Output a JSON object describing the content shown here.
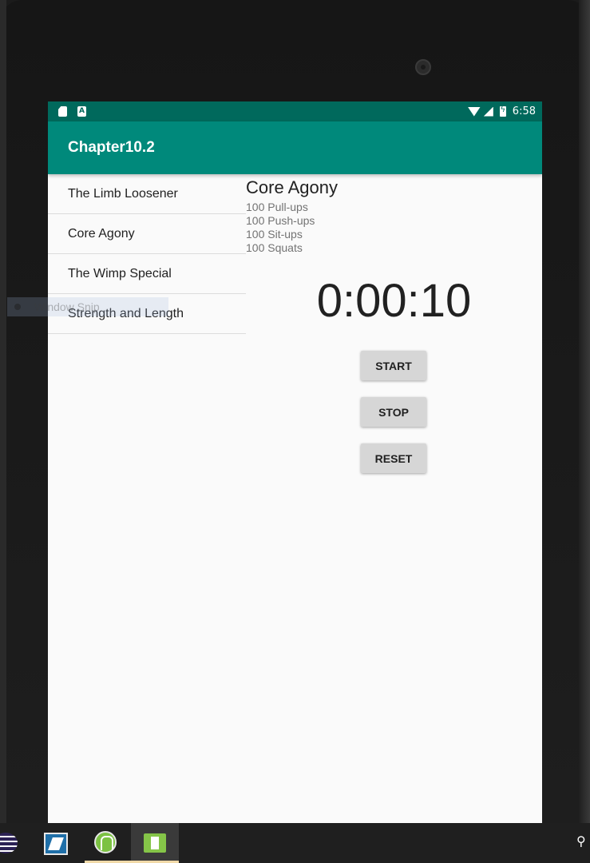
{
  "status_bar": {
    "time": "6:58",
    "icons": [
      "sd-card-icon",
      "a-badge-icon",
      "wifi-icon",
      "cell-signal-icon",
      "battery-charging-icon"
    ]
  },
  "app_bar": {
    "title": "Chapter10.2"
  },
  "workout_list": {
    "items": [
      {
        "label": "The Limb Loosener"
      },
      {
        "label": "Core Agony"
      },
      {
        "label": "The Wimp Special"
      },
      {
        "label": "Strength and Length"
      }
    ]
  },
  "detail": {
    "title": "Core Agony",
    "description_lines": [
      "100 Pull-ups",
      "100 Push-ups",
      "100 Sit-ups",
      "100 Squats"
    ],
    "timer": "0:00:10",
    "buttons": {
      "start": "START",
      "stop": "STOP",
      "reset": "RESET"
    }
  },
  "overlay": {
    "window_snip_label": "Window Snip"
  },
  "taskbar": {
    "apps": [
      "eclipse-icon",
      "tablet-app-icon",
      "android-studio-icon",
      "emulator-icon",
      "people-icon"
    ],
    "accent_color": "#f0d9a8"
  },
  "colors": {
    "status_bar": "#00695c",
    "app_bar": "#00897b",
    "background": "#fafafa",
    "button": "#d6d6d6"
  }
}
